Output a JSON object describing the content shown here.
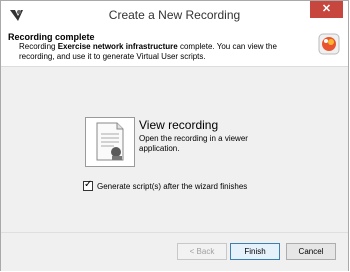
{
  "window": {
    "title": "Create a New Recording",
    "close_label": "✕"
  },
  "header": {
    "title": "Recording complete",
    "text_prefix": "Recording ",
    "text_bold": "Exercise network infrastructure",
    "text_suffix": " complete. You can view the recording, and use it to generate Virtual User scripts."
  },
  "main": {
    "view_title": "View recording",
    "view_desc": "Open the recording in a viewer application.",
    "checkbox_label": "Generate script(s) after the wizard finishes",
    "checkbox_checked": true
  },
  "footer": {
    "back_label": "< Back",
    "finish_label": "Finish",
    "cancel_label": "Cancel"
  },
  "colors": {
    "close_button": "#c7463d",
    "default_button_border": "#3c7fb1"
  },
  "icons": {
    "app": "app-logo-icon",
    "header": "recording-badge-icon",
    "view": "document-viewer-icon"
  }
}
